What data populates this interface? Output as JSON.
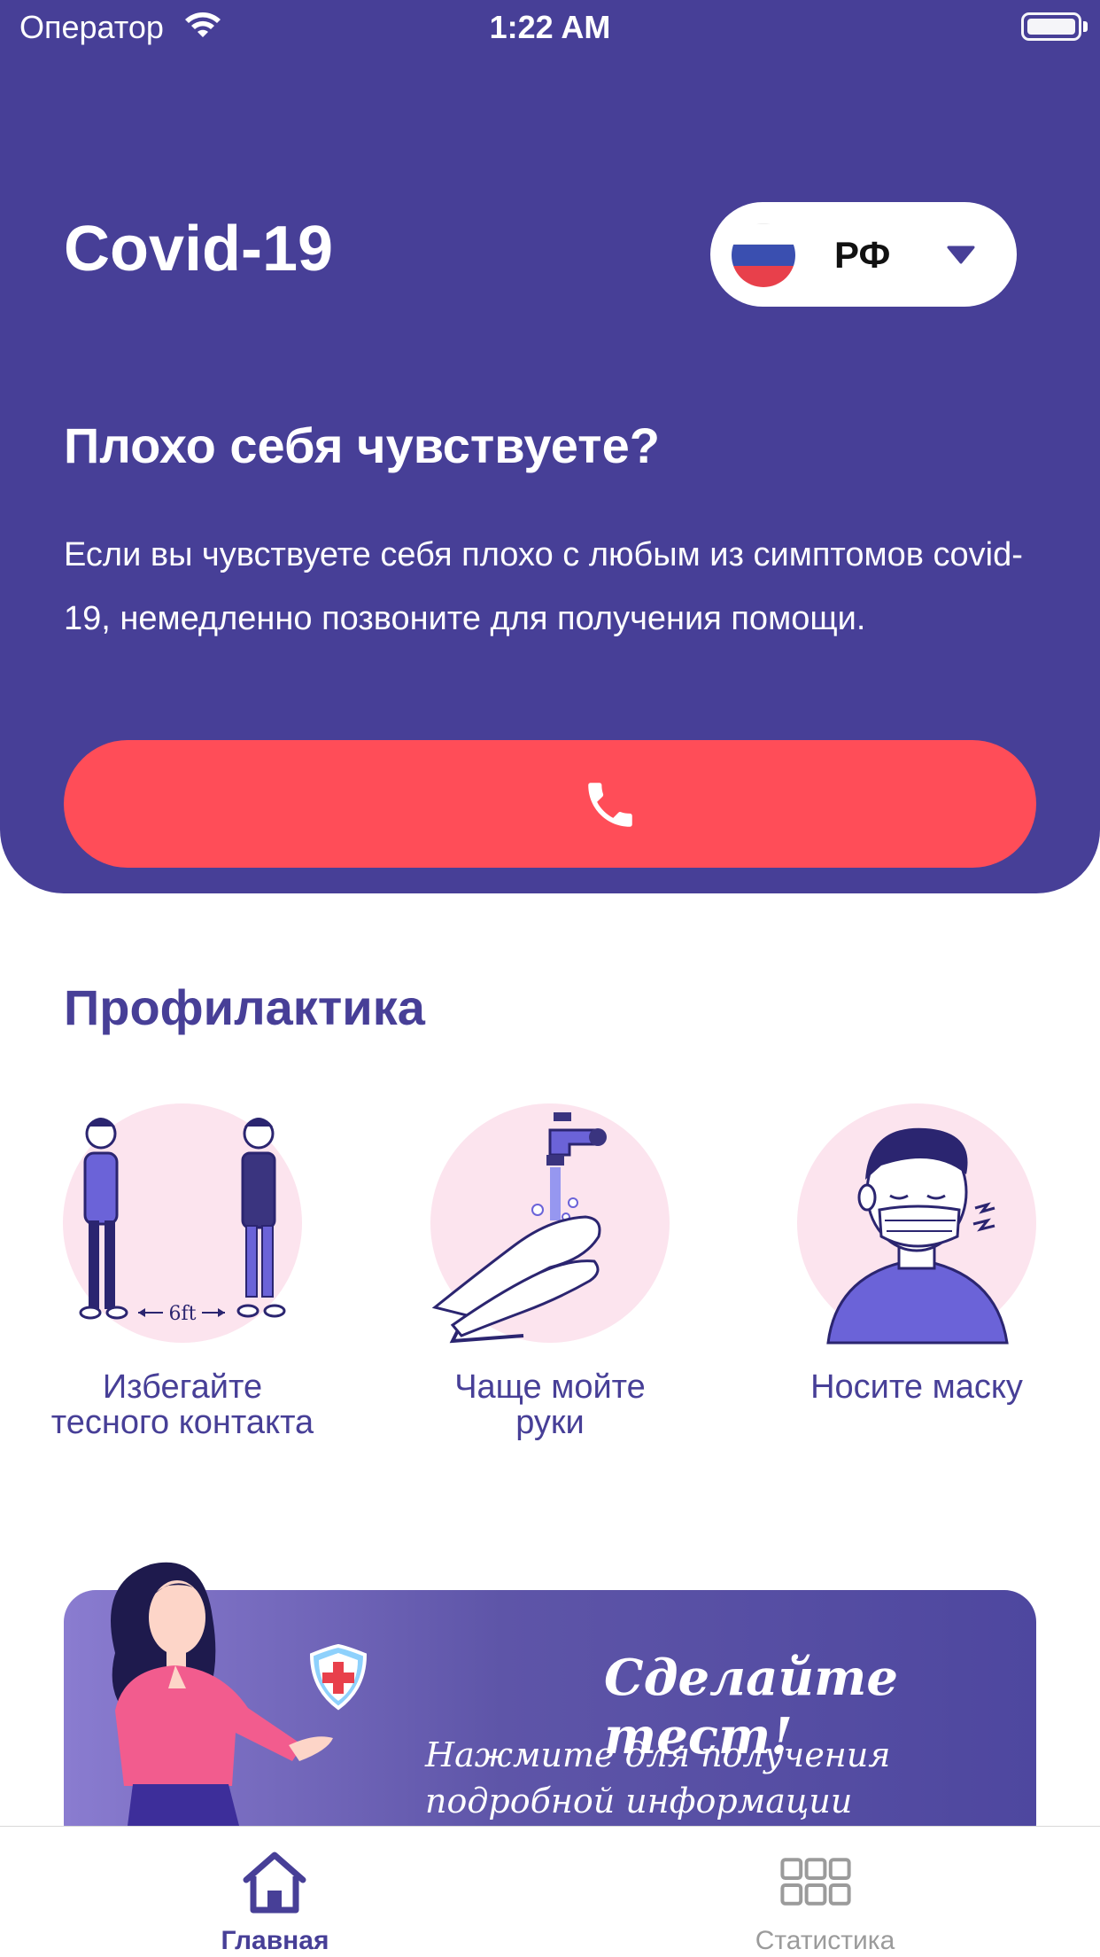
{
  "status_bar": {
    "carrier": "Оператор",
    "time": "1:22 AM"
  },
  "header": {
    "title": "Covid-19",
    "country": {
      "label": "РФ",
      "flag_colors": [
        "#FFFFFF",
        "#3A4FB0",
        "#E8404B"
      ]
    },
    "question": "Плохо себя чувствуете?",
    "description": "Если вы чувствуете себя плохо с любым из симптомов covid-19, немедленно позвоните для получения помощи.",
    "call_icon": "phone-icon"
  },
  "prevention": {
    "title": "Профилактика",
    "items": [
      {
        "label": "Избегайте тесного контакта",
        "art_text": "6ft"
      },
      {
        "label": "Чаще мойте руки"
      },
      {
        "label": "Носите маску"
      }
    ]
  },
  "test_banner": {
    "title": "Сделайте тест!",
    "subtitle": "Нажмите для получения подробной информации"
  },
  "tab_bar": {
    "tabs": [
      {
        "label": "Главная",
        "icon": "home-icon",
        "active": true
      },
      {
        "label": "Статистика",
        "icon": "grid-icon",
        "active": false
      }
    ]
  },
  "colors": {
    "primary": "#473F97",
    "accent": "#FF4D58",
    "pink": "#FCE4EE",
    "inactive": "#9B9B9B"
  }
}
